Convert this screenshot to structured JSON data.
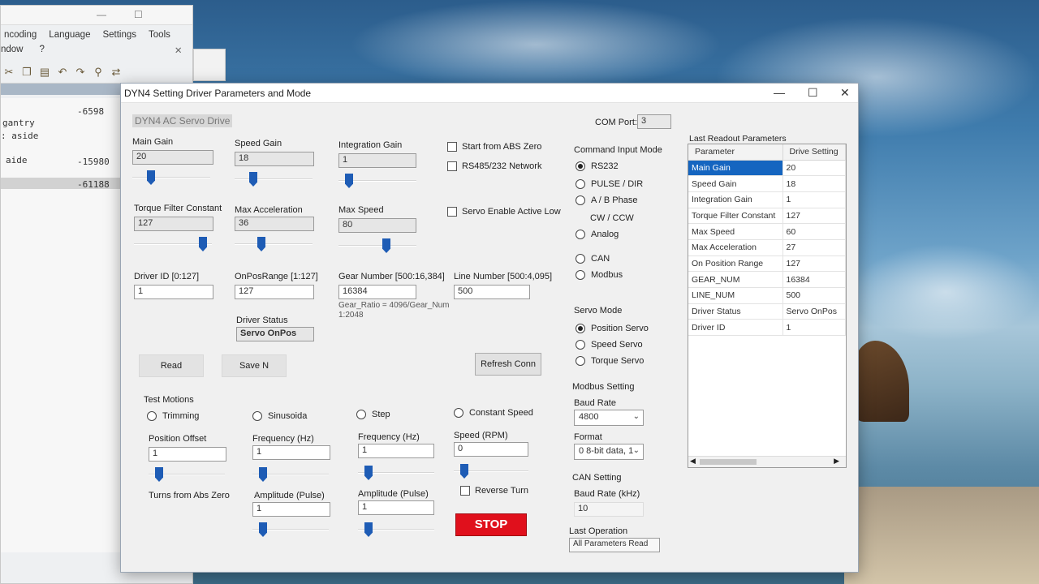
{
  "background_editor": {
    "menu": [
      "ncoding",
      "Language",
      "Settings",
      "Tools"
    ],
    "menu2": [
      "ndow",
      "?"
    ],
    "code_lines": [
      {
        "left": "gantry",
        "right": ""
      },
      {
        "left": ": aside",
        "right": "-6598"
      },
      {
        "left": "aide",
        "right": "-15980"
      },
      {
        "left": "",
        "right": "-61188"
      }
    ]
  },
  "dialog": {
    "title": "DYN4 Setting Driver Parameters and Mode",
    "subtitle": "DYN4 AC Servo Drive",
    "com_port_label": "COM Port:",
    "com_port_value": "3",
    "gains": {
      "main_gain_label": "Main Gain",
      "main_gain_value": "20",
      "speed_gain_label": "Speed Gain",
      "speed_gain_value": "18",
      "integration_gain_label": "Integration Gain",
      "integration_gain_value": "1",
      "torque_filter_label": "Torque Filter Constant",
      "torque_filter_value": "127",
      "max_accel_label": "Max Acceleration",
      "max_accel_value": "36",
      "max_speed_label": "Max Speed",
      "max_speed_value": "80"
    },
    "ids": {
      "driver_id_label": "Driver ID  [0:127]",
      "driver_id_value": "1",
      "onpos_label": "OnPosRange  [1:127]",
      "onpos_value": "127",
      "gear_label": "Gear Number  [500:16,384]",
      "gear_value": "16384",
      "line_label": "Line Number  [500:4,095]",
      "line_value": "500",
      "gear_ratio_line1": "Gear_Ratio = 4096/Gear_Num",
      "gear_ratio_line2": "1:2048",
      "driver_status_label": "Driver Status",
      "driver_status_value": "Servo OnPos"
    },
    "checks": {
      "abs_zero": "Start from ABS Zero",
      "rs485": "RS485/232 Network",
      "servo_enable": "Servo Enable Active Low"
    },
    "buttons": {
      "read": "Read",
      "save": "Save N",
      "refresh": "Refresh Conn",
      "stop": "STOP"
    },
    "command_input": {
      "title": "Command Input Mode",
      "options": [
        "RS232",
        "PULSE / DIR",
        "A / B Phase",
        "CW / CCW",
        "Analog",
        "CAN",
        "Modbus"
      ],
      "selected": "RS232"
    },
    "servo_mode": {
      "title": "Servo Mode",
      "options": [
        "Position Servo",
        "Speed Servo",
        "Torque Servo"
      ],
      "selected": "Position Servo"
    },
    "modbus": {
      "title": "Modbus Setting",
      "baud_label": "Baud Rate",
      "baud_value": "4800",
      "format_label": "Format",
      "format_value": "0  8-bit data, 1"
    },
    "can": {
      "title": "CAN Setting",
      "baud_label": "Baud Rate (kHz)",
      "baud_value": "10"
    },
    "last_operation": {
      "label": "Last Operation",
      "value": "All Parameters Read"
    },
    "test_motions": {
      "title": "Test Motions",
      "trimming": "Trimming",
      "sinusoidal": "Sinusoida",
      "step": "Step",
      "constant_speed": "Constant Speed",
      "position_offset_label": "Position Offset",
      "position_offset_value": "1",
      "frequency_label": "Frequency (Hz)",
      "frequency_value": "1",
      "frequency2_label": "Frequency (Hz)",
      "frequency2_value": "1",
      "speed_label": "Speed (RPM)",
      "speed_value": "0",
      "reverse_turn": "Reverse Turn",
      "turns_label": "Turns from Abs Zero",
      "amplitude_label": "Amplitude (Pulse)",
      "amplitude_value": "1",
      "amplitude2_label": "Amplitude (Pulse)",
      "amplitude2_value": "1"
    },
    "readout": {
      "title": "Last Readout Parameters",
      "headers": [
        "Parameter",
        "Drive Setting"
      ],
      "rows": [
        [
          "Main Gain",
          "20"
        ],
        [
          "Speed Gain",
          "18"
        ],
        [
          "Integration Gain",
          "1"
        ],
        [
          "Torque Filter Constant",
          "127"
        ],
        [
          "Max Speed",
          "60"
        ],
        [
          "Max Acceleration",
          "27"
        ],
        [
          "On Position Range",
          "127"
        ],
        [
          "GEAR_NUM",
          "16384"
        ],
        [
          "LINE_NUM",
          "500"
        ],
        [
          "Driver Status",
          "Servo OnPos"
        ],
        [
          "Driver ID",
          "1"
        ]
      ]
    }
  }
}
